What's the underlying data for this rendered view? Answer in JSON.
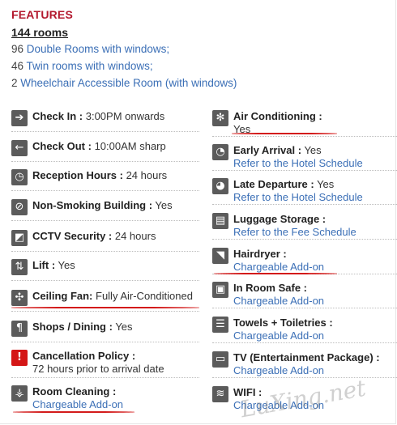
{
  "header": {
    "title": "FEATURES",
    "rooms": "144 rooms"
  },
  "room_lines": [
    {
      "count": "96 ",
      "link": "Double Rooms with windows;"
    },
    {
      "count": "46 ",
      "link": "Twin rooms with windows;"
    },
    {
      "count": "2 ",
      "link": "Wheelchair Accessible Room (with windows)"
    }
  ],
  "left": [
    {
      "icon": "arrow-right-icon",
      "label": "Check In :",
      "value": " 3:00PM onwards"
    },
    {
      "icon": "arrow-left-icon",
      "label": "Check Out :",
      "value": " 10:00AM sharp"
    },
    {
      "icon": "clock-icon",
      "label": "Reception Hours :",
      "value": " 24 hours"
    },
    {
      "icon": "no-smoking-icon",
      "label": "Non-Smoking Building :",
      "value": " Yes"
    },
    {
      "icon": "cctv-icon",
      "label": "CCTV Security :",
      "value": " 24 hours"
    },
    {
      "icon": "lift-icon",
      "label": "Lift :",
      "value": " Yes"
    },
    {
      "icon": "fan-icon",
      "label": "Ceiling Fan:",
      "value": " Fully Air-Conditioned"
    },
    {
      "icon": "shops-dining-icon",
      "label": "Shops / Dining :",
      "value": " Yes"
    },
    {
      "icon": "exclamation-icon",
      "label": "Cancellation Policy :",
      "sub": "72 hours prior to arrival date"
    },
    {
      "icon": "room-cleaning-icon",
      "label": "Room Cleaning :",
      "sub": "Chargeable Add-on"
    }
  ],
  "right": [
    {
      "icon": "snowflake-icon",
      "label": "Air Conditioning :",
      "sub": "Yes"
    },
    {
      "icon": "early-arrival-icon",
      "label": "Early Arrival :",
      "value": " Yes",
      "sub": "Refer to the Hotel Schedule"
    },
    {
      "icon": "late-departure-icon",
      "label": "Late Departure :",
      "value": " Yes",
      "sub": "Refer to the Hotel Schedule"
    },
    {
      "icon": "luggage-icon",
      "label": "Luggage Storage :",
      "sub": "Refer to the Fee Schedule"
    },
    {
      "icon": "hairdryer-icon",
      "label": "Hairdryer :",
      "sub": "Chargeable Add-on"
    },
    {
      "icon": "safe-icon",
      "label": "In Room Safe :",
      "sub": "Chargeable Add-on"
    },
    {
      "icon": "towels-icon",
      "label": "Towels + Toiletries :",
      "sub": "Chargeable Add-on"
    },
    {
      "icon": "tv-icon",
      "label": "TV (Entertainment Package) :",
      "sub": "Chargeable Add-on"
    },
    {
      "icon": "wifi-icon",
      "label": "WIFI :",
      "sub": "Chargeable Add-on"
    }
  ],
  "watermark": "LuXing.net",
  "colors": {
    "header": "#b3182d",
    "link": "#3b6fb6",
    "annotation": "#d31a1a"
  }
}
